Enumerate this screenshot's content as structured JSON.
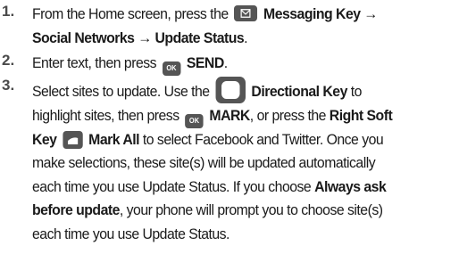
{
  "steps": [
    {
      "number": "1.",
      "lines": [
        {
          "pre": "From the Home screen, press the",
          "key_label": "Messaging Key →"
        },
        {
          "bold": "Social Networks → Update Status",
          "post": "."
        }
      ]
    },
    {
      "number": "2.",
      "lines": [
        {
          "pre": "Enter text, then press",
          "key_text": "OK",
          "bold": "SEND",
          "post": "."
        }
      ]
    },
    {
      "number": "3.",
      "lines": [
        {
          "pre": "Select sites to update. Use the",
          "bold": "Directional Key",
          "post": "to"
        },
        {
          "pre": "highlight sites, then press",
          "key_text": "OK",
          "bold": "MARK",
          "mid": ", or press the",
          "bold2": "Right Soft"
        },
        {
          "bold": "Key",
          "bold2": "Mark All",
          "post": "to select Facebook and Twitter. Once you"
        },
        {
          "text": "make selections, these site(s) will be updated automatically"
        },
        {
          "pre": "each time you use Update Status. If you choose",
          "bold": "Always ask"
        },
        {
          "bold": "before update",
          "post": ", your phone will prompt you to choose site(s)"
        },
        {
          "text": "each time you use Update Status."
        }
      ]
    }
  ],
  "icons": {
    "messaging_key": "envelope-key-icon",
    "ok_key": "ok-key-icon",
    "directional_key": "directional-key-icon",
    "right_soft_key": "right-soft-key-icon"
  },
  "colors": {
    "text": "#1a1a1a",
    "number": "#4a4a4a",
    "key": "#555555"
  }
}
